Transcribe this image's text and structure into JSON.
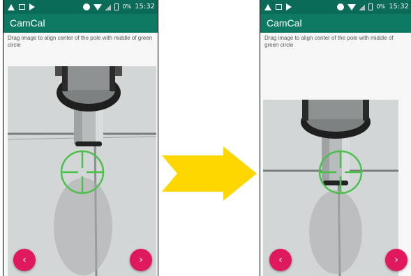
{
  "before": {
    "status_time": "15:32",
    "battery_pct": "0%",
    "app_title": "CamCal",
    "instruction": "Drag image to align center of the pole with middle of green circle",
    "prev_label": "‹",
    "next_label": "›"
  },
  "after": {
    "status_time": "15:32",
    "battery_pct": "0%",
    "app_title": "CamCal",
    "instruction": "Drag image to align center of the pole with middle of green circle",
    "prev_label": "‹",
    "next_label": "›"
  },
  "icons": {
    "status_left": [
      "warning-icon",
      "image-icon",
      "play-icon"
    ],
    "status_right": [
      "circle-icon",
      "wifi-icon",
      "signal-icon",
      "battery-icon"
    ],
    "transition": "arrow-right-icon"
  },
  "colors": {
    "status_bar": "#0a6b58",
    "app_bar": "#0f7a63",
    "fab": "#e0195e",
    "crosshair": "#4cc04a",
    "arrow": "#ffd700"
  }
}
